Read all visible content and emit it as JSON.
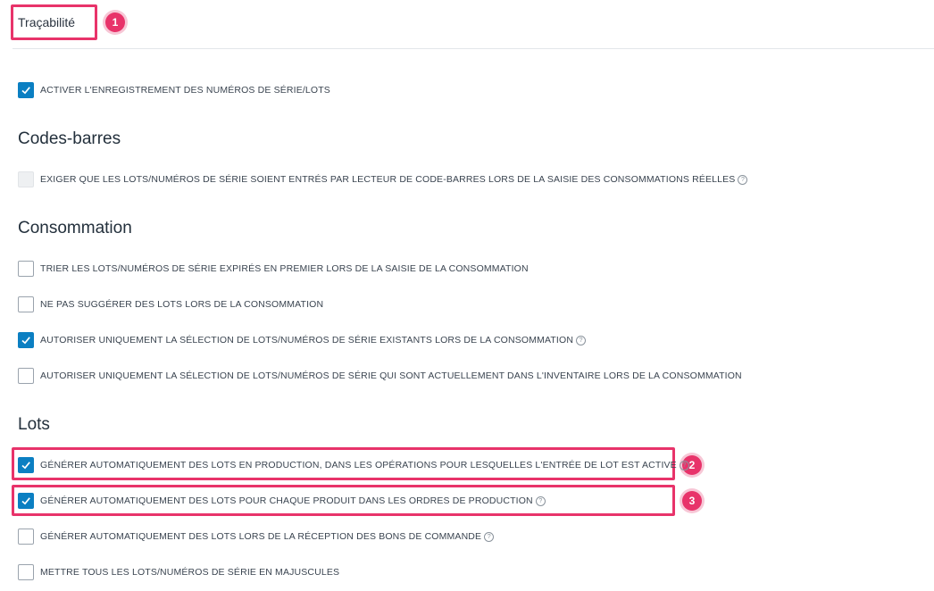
{
  "page": {
    "title": "Traçabilité"
  },
  "annotations": [
    "1",
    "2",
    "3"
  ],
  "top_option": {
    "label": "ACTIVER L'ENREGISTREMENT DES NUMÉROS DE SÉRIE/LOTS",
    "checked": true
  },
  "sections": {
    "barcodes": {
      "title": "Codes-barres",
      "items": [
        {
          "label": "EXIGER QUE LES LOTS/NUMÉROS DE SÉRIE SOIENT ENTRÉS PAR LECTEUR DE CODE-BARRES LORS DE LA SAISIE DES CONSOMMATIONS RÉELLES",
          "checked": false,
          "disabled": true,
          "help": true
        }
      ]
    },
    "consumption": {
      "title": "Consommation",
      "items": [
        {
          "label": "TRIER LES LOTS/NUMÉROS DE SÉRIE EXPIRÉS EN PREMIER LORS DE LA SAISIE DE LA CONSOMMATION",
          "checked": false
        },
        {
          "label": "NE PAS SUGGÉRER DES LOTS LORS DE LA CONSOMMATION",
          "checked": false
        },
        {
          "label": "AUTORISER UNIQUEMENT LA SÉLECTION DE LOTS/NUMÉROS DE SÉRIE EXISTANTS LORS DE LA CONSOMMATION",
          "checked": true,
          "help": true
        },
        {
          "label": "AUTORISER UNIQUEMENT LA SÉLECTION DE LOTS/NUMÉROS DE SÉRIE QUI SONT ACTUELLEMENT DANS L'INVENTAIRE LORS DE LA CONSOMMATION",
          "checked": false
        }
      ]
    },
    "lots": {
      "title": "Lots",
      "items": [
        {
          "label": "GÉNÉRER AUTOMATIQUEMENT DES LOTS EN PRODUCTION, DANS LES OPÉRATIONS POUR LESQUELLES L'ENTRÉE DE LOT EST ACTIVE",
          "checked": true,
          "help": true
        },
        {
          "label": "GÉNÉRER AUTOMATIQUEMENT DES LOTS POUR CHAQUE PRODUIT DANS LES ORDRES DE PRODUCTION",
          "checked": true,
          "help": true
        },
        {
          "label": "GÉNÉRER AUTOMATIQUEMENT DES LOTS LORS DE LA RÉCEPTION DES BONS DE COMMANDE",
          "checked": false,
          "help": true
        },
        {
          "label": "METTRE TOUS LES LOTS/NUMÉROS DE SÉRIE EN MAJUSCULES",
          "checked": false
        }
      ]
    }
  },
  "colors": {
    "accent": "#0b7fc2",
    "highlight": "#e8336a"
  }
}
